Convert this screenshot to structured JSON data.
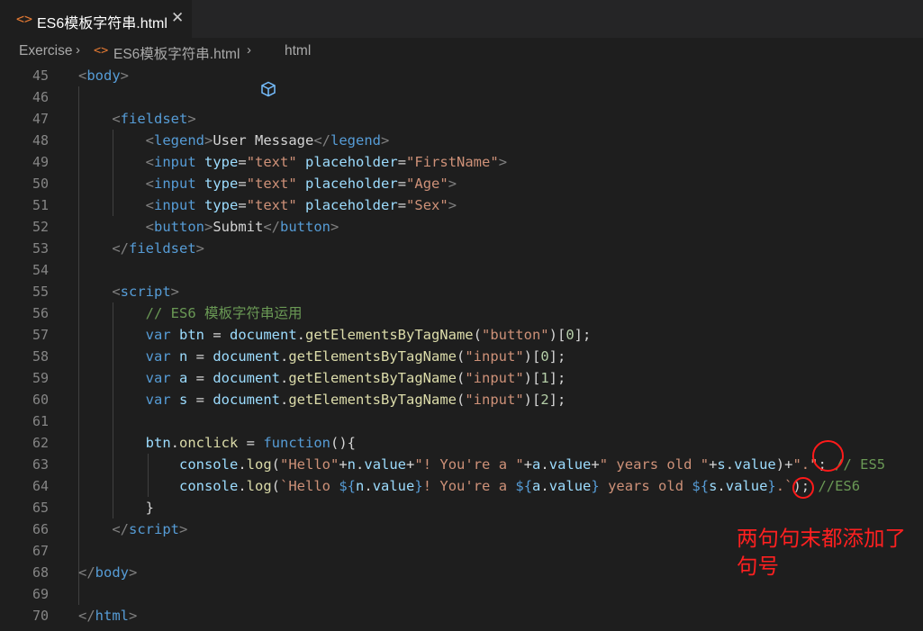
{
  "tab": {
    "icon": "code-icon",
    "label": "ES6模板字符串.html",
    "close": "✕"
  },
  "breadcrumb": {
    "items": [
      {
        "label": "Exercise",
        "icon": ""
      },
      {
        "label": "ES6模板字符串.html",
        "icon": "code-icon"
      },
      {
        "label": "html",
        "icon": "cube-icon"
      }
    ],
    "separator": "›"
  },
  "lines": [
    {
      "n": "45",
      "code": [
        [
          "tg",
          "<"
        ],
        [
          "tn",
          "body"
        ],
        [
          "tg",
          ">"
        ]
      ]
    },
    {
      "n": "46",
      "code": []
    },
    {
      "n": "47",
      "code": [
        [
          "tx",
          "    "
        ],
        [
          "tg",
          "<"
        ],
        [
          "tn",
          "fieldset"
        ],
        [
          "tg",
          ">"
        ]
      ]
    },
    {
      "n": "48",
      "code": [
        [
          "tx",
          "        "
        ],
        [
          "tg",
          "<"
        ],
        [
          "tn",
          "legend"
        ],
        [
          "tg",
          ">"
        ],
        [
          "tx",
          "User Message"
        ],
        [
          "tg",
          "</"
        ],
        [
          "tn",
          "legend"
        ],
        [
          "tg",
          ">"
        ]
      ]
    },
    {
      "n": "49",
      "code": [
        [
          "tx",
          "        "
        ],
        [
          "tg",
          "<"
        ],
        [
          "tn",
          "input"
        ],
        [
          "tx",
          " "
        ],
        [
          "at",
          "type"
        ],
        [
          "tx",
          "="
        ],
        [
          "st",
          "\"text\""
        ],
        [
          "tx",
          " "
        ],
        [
          "at",
          "placeholder"
        ],
        [
          "tx",
          "="
        ],
        [
          "st",
          "\"FirstName\""
        ],
        [
          "tg",
          ">"
        ]
      ]
    },
    {
      "n": "50",
      "code": [
        [
          "tx",
          "        "
        ],
        [
          "tg",
          "<"
        ],
        [
          "tn",
          "input"
        ],
        [
          "tx",
          " "
        ],
        [
          "at",
          "type"
        ],
        [
          "tx",
          "="
        ],
        [
          "st",
          "\"text\""
        ],
        [
          "tx",
          " "
        ],
        [
          "at",
          "placeholder"
        ],
        [
          "tx",
          "="
        ],
        [
          "st",
          "\"Age\""
        ],
        [
          "tg",
          ">"
        ]
      ]
    },
    {
      "n": "51",
      "code": [
        [
          "tx",
          "        "
        ],
        [
          "tg",
          "<"
        ],
        [
          "tn",
          "input"
        ],
        [
          "tx",
          " "
        ],
        [
          "at",
          "type"
        ],
        [
          "tx",
          "="
        ],
        [
          "st",
          "\"text\""
        ],
        [
          "tx",
          " "
        ],
        [
          "at",
          "placeholder"
        ],
        [
          "tx",
          "="
        ],
        [
          "st",
          "\"Sex\""
        ],
        [
          "tg",
          ">"
        ]
      ]
    },
    {
      "n": "52",
      "code": [
        [
          "tx",
          "        "
        ],
        [
          "tg",
          "<"
        ],
        [
          "tn",
          "button"
        ],
        [
          "tg",
          ">"
        ],
        [
          "tx",
          "Submit"
        ],
        [
          "tg",
          "</"
        ],
        [
          "tn",
          "button"
        ],
        [
          "tg",
          ">"
        ]
      ]
    },
    {
      "n": "53",
      "code": [
        [
          "tx",
          "    "
        ],
        [
          "tg",
          "</"
        ],
        [
          "tn",
          "fieldset"
        ],
        [
          "tg",
          ">"
        ]
      ]
    },
    {
      "n": "54",
      "code": []
    },
    {
      "n": "55",
      "code": [
        [
          "tx",
          "    "
        ],
        [
          "tg",
          "<"
        ],
        [
          "tn",
          "script"
        ],
        [
          "tg",
          ">"
        ]
      ]
    },
    {
      "n": "56",
      "code": [
        [
          "tx",
          "        "
        ],
        [
          "cm",
          "// ES6 模板字符串运用"
        ]
      ]
    },
    {
      "n": "57",
      "code": [
        [
          "tx",
          "        "
        ],
        [
          "kw",
          "var"
        ],
        [
          "tx",
          " "
        ],
        [
          "vr",
          "btn"
        ],
        [
          "tx",
          " = "
        ],
        [
          "vr",
          "document"
        ],
        [
          "tx",
          "."
        ],
        [
          "fn",
          "getElementsByTagName"
        ],
        [
          "tx",
          "("
        ],
        [
          "st",
          "\"button\""
        ],
        [
          "tx",
          ")["
        ],
        [
          "nm",
          "0"
        ],
        [
          "tx",
          "];"
        ]
      ]
    },
    {
      "n": "58",
      "code": [
        [
          "tx",
          "        "
        ],
        [
          "kw",
          "var"
        ],
        [
          "tx",
          " "
        ],
        [
          "vr",
          "n"
        ],
        [
          "tx",
          " = "
        ],
        [
          "vr",
          "document"
        ],
        [
          "tx",
          "."
        ],
        [
          "fn",
          "getElementsByTagName"
        ],
        [
          "tx",
          "("
        ],
        [
          "st",
          "\"input\""
        ],
        [
          "tx",
          ")["
        ],
        [
          "nm",
          "0"
        ],
        [
          "tx",
          "];"
        ]
      ]
    },
    {
      "n": "59",
      "code": [
        [
          "tx",
          "        "
        ],
        [
          "kw",
          "var"
        ],
        [
          "tx",
          " "
        ],
        [
          "vr",
          "a"
        ],
        [
          "tx",
          " = "
        ],
        [
          "vr",
          "document"
        ],
        [
          "tx",
          "."
        ],
        [
          "fn",
          "getElementsByTagName"
        ],
        [
          "tx",
          "("
        ],
        [
          "st",
          "\"input\""
        ],
        [
          "tx",
          ")["
        ],
        [
          "nm",
          "1"
        ],
        [
          "tx",
          "];"
        ]
      ]
    },
    {
      "n": "60",
      "code": [
        [
          "tx",
          "        "
        ],
        [
          "kw",
          "var"
        ],
        [
          "tx",
          " "
        ],
        [
          "vr",
          "s"
        ],
        [
          "tx",
          " = "
        ],
        [
          "vr",
          "document"
        ],
        [
          "tx",
          "."
        ],
        [
          "fn",
          "getElementsByTagName"
        ],
        [
          "tx",
          "("
        ],
        [
          "st",
          "\"input\""
        ],
        [
          "tx",
          ")["
        ],
        [
          "nm",
          "2"
        ],
        [
          "tx",
          "];"
        ]
      ]
    },
    {
      "n": "61",
      "code": []
    },
    {
      "n": "62",
      "code": [
        [
          "tx",
          "        "
        ],
        [
          "vr",
          "btn"
        ],
        [
          "tx",
          "."
        ],
        [
          "fn",
          "onclick"
        ],
        [
          "tx",
          " = "
        ],
        [
          "kw",
          "function"
        ],
        [
          "tx",
          "(){"
        ]
      ]
    },
    {
      "n": "63",
      "code": [
        [
          "tx",
          "            "
        ],
        [
          "vr",
          "console"
        ],
        [
          "tx",
          "."
        ],
        [
          "fn",
          "log"
        ],
        [
          "tx",
          "("
        ],
        [
          "st",
          "\"Hello\""
        ],
        [
          "tx",
          "+"
        ],
        [
          "vr",
          "n"
        ],
        [
          "tx",
          "."
        ],
        [
          "vr",
          "value"
        ],
        [
          "tx",
          "+"
        ],
        [
          "st",
          "\"! You're a \""
        ],
        [
          "tx",
          "+"
        ],
        [
          "vr",
          "a"
        ],
        [
          "tx",
          "."
        ],
        [
          "vr",
          "value"
        ],
        [
          "tx",
          "+"
        ],
        [
          "st",
          "\" years old \""
        ],
        [
          "tx",
          "+"
        ],
        [
          "vr",
          "s"
        ],
        [
          "tx",
          "."
        ],
        [
          "vr",
          "value"
        ],
        [
          "tx",
          ")+"
        ],
        [
          "st",
          "\".\""
        ],
        [
          "tx",
          "; "
        ],
        [
          "cm",
          "// ES5"
        ]
      ]
    },
    {
      "n": "64",
      "code": [
        [
          "tx",
          "            "
        ],
        [
          "vr",
          "console"
        ],
        [
          "tx",
          "."
        ],
        [
          "fn",
          "log"
        ],
        [
          "tx",
          "("
        ],
        [
          "st",
          "`Hello "
        ],
        [
          "kw",
          "${"
        ],
        [
          "vr",
          "n"
        ],
        [
          "tx",
          "."
        ],
        [
          "vr",
          "value"
        ],
        [
          "kw",
          "}"
        ],
        [
          "st",
          "! You're a "
        ],
        [
          "kw",
          "${"
        ],
        [
          "vr",
          "a"
        ],
        [
          "tx",
          "."
        ],
        [
          "vr",
          "value"
        ],
        [
          "kw",
          "}"
        ],
        [
          "st",
          " years old "
        ],
        [
          "kw",
          "${"
        ],
        [
          "vr",
          "s"
        ],
        [
          "tx",
          "."
        ],
        [
          "vr",
          "value"
        ],
        [
          "kw",
          "}"
        ],
        [
          "st",
          ".`"
        ],
        [
          "tx",
          "); "
        ],
        [
          "cm",
          "//ES6"
        ]
      ]
    },
    {
      "n": "65",
      "code": [
        [
          "tx",
          "        }"
        ]
      ]
    },
    {
      "n": "66",
      "code": [
        [
          "tx",
          "    "
        ],
        [
          "tg",
          "</"
        ],
        [
          "tn",
          "script"
        ],
        [
          "tg",
          ">"
        ]
      ]
    },
    {
      "n": "67",
      "code": []
    },
    {
      "n": "68",
      "code": [
        [
          "tg",
          "</"
        ],
        [
          "tn",
          "body"
        ],
        [
          "tg",
          ">"
        ]
      ]
    },
    {
      "n": "69",
      "code": []
    },
    {
      "n": "70",
      "code": [
        [
          "tg",
          "</"
        ],
        [
          "tn",
          "html"
        ],
        [
          "tg",
          ">"
        ]
      ]
    }
  ],
  "annotation": {
    "text": "两句句末都添加了句号",
    "color": "#ff2020"
  },
  "colors": {
    "editor_bg": "#1e1e1e",
    "tab_bar_bg": "#252526",
    "tag_name": "#569cd6",
    "attribute": "#9cdcfe",
    "string": "#ce9178",
    "comment": "#6a9955",
    "function": "#dcdcaa",
    "number": "#b5cea8"
  }
}
